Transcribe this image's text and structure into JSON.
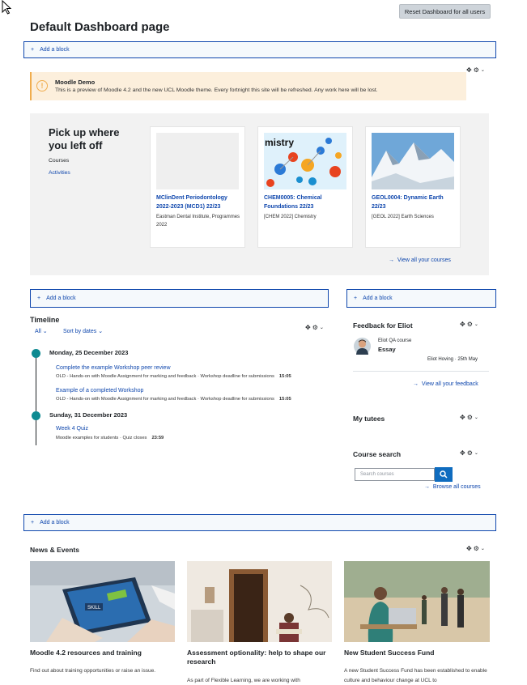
{
  "header": {
    "reset_label": "Reset Dashboard for all users",
    "page_title": "Default Dashboard page"
  },
  "add_block_label": "Add a block",
  "alert": {
    "title": "Moodle Demo",
    "text": "This is a preview of Moodle 4.2 and the new UCL Moodle theme. Every fortnight this site will be refreshed. Any work here will be lost.",
    "icon": "exclamation-icon",
    "accent": "#f0ad4e"
  },
  "recent": {
    "title": "Pick up where you left off",
    "courses_label": "Courses",
    "activities_label": "Activities",
    "cards": [
      {
        "title": "MClinDent Periodontology 2022-2023 (MCD1) 22/23",
        "sub": "Eastman Dental Institute, Programmes 2022",
        "image": "placeholder"
      },
      {
        "title": "CHEM0005: Chemical Foundations 22/23",
        "sub": "[CHEM 2022] Chemistry",
        "image": "chemistry-molecules",
        "image_text": "mistry"
      },
      {
        "title": "GEOL0004: Dynamic Earth 22/23",
        "sub": "[GEOL 2022] Earth Sciences",
        "image": "snowy-mountains"
      }
    ],
    "view_all": "View all your courses"
  },
  "timeline": {
    "title": "Timeline",
    "filter_all": "All",
    "filter_sort": "Sort by dates",
    "days": [
      {
        "date": "Monday, 25 December 2023",
        "events": [
          {
            "name": "Complete the example Workshop peer review",
            "meta": "OLD - Hands-on with Moodle Assignment for marking and feedback · Workshop deadline for submissions",
            "time": "15:05"
          },
          {
            "name": "Example of a completed Workshop",
            "meta": "OLD - Hands-on with Moodle Assignment for marking and feedback · Workshop deadline for submissions",
            "time": "15:05"
          }
        ]
      },
      {
        "date": "Sunday, 31 December 2023",
        "events": [
          {
            "name": "Week 4 Quiz",
            "meta": "Moodle examples for students · Quiz closes",
            "time": "23:59"
          }
        ]
      }
    ]
  },
  "feedback": {
    "title": "Feedback for Eliot",
    "course": "Eliot QA course",
    "item": "Essay",
    "by": "Eliot Hoving · 25th May",
    "view_all": "View all your feedback"
  },
  "tutees": {
    "title": "My tutees"
  },
  "course_search": {
    "title": "Course search",
    "placeholder": "Search courses",
    "browse": "Browse all courses"
  },
  "news": {
    "title": "News & Events",
    "items": [
      {
        "headline": "Moodle 4.2 resources and training",
        "text": "Find out about training opportunities or raise an issue.",
        "image": "laptop-skills"
      },
      {
        "headline": "Assessment optionality: help to shape our research",
        "text": "As part of Flexible Learning, we are working with",
        "image": "student-reading"
      },
      {
        "headline": "New Student Success Fund",
        "text": "A new Student Success Fund has been established to enable culture and behaviour change at UCL to",
        "image": "student-laptop-campus"
      }
    ]
  },
  "colors": {
    "link": "#0f47ad",
    "timeline_dot": "#0e8a91",
    "search_button": "#0f6cbf"
  }
}
